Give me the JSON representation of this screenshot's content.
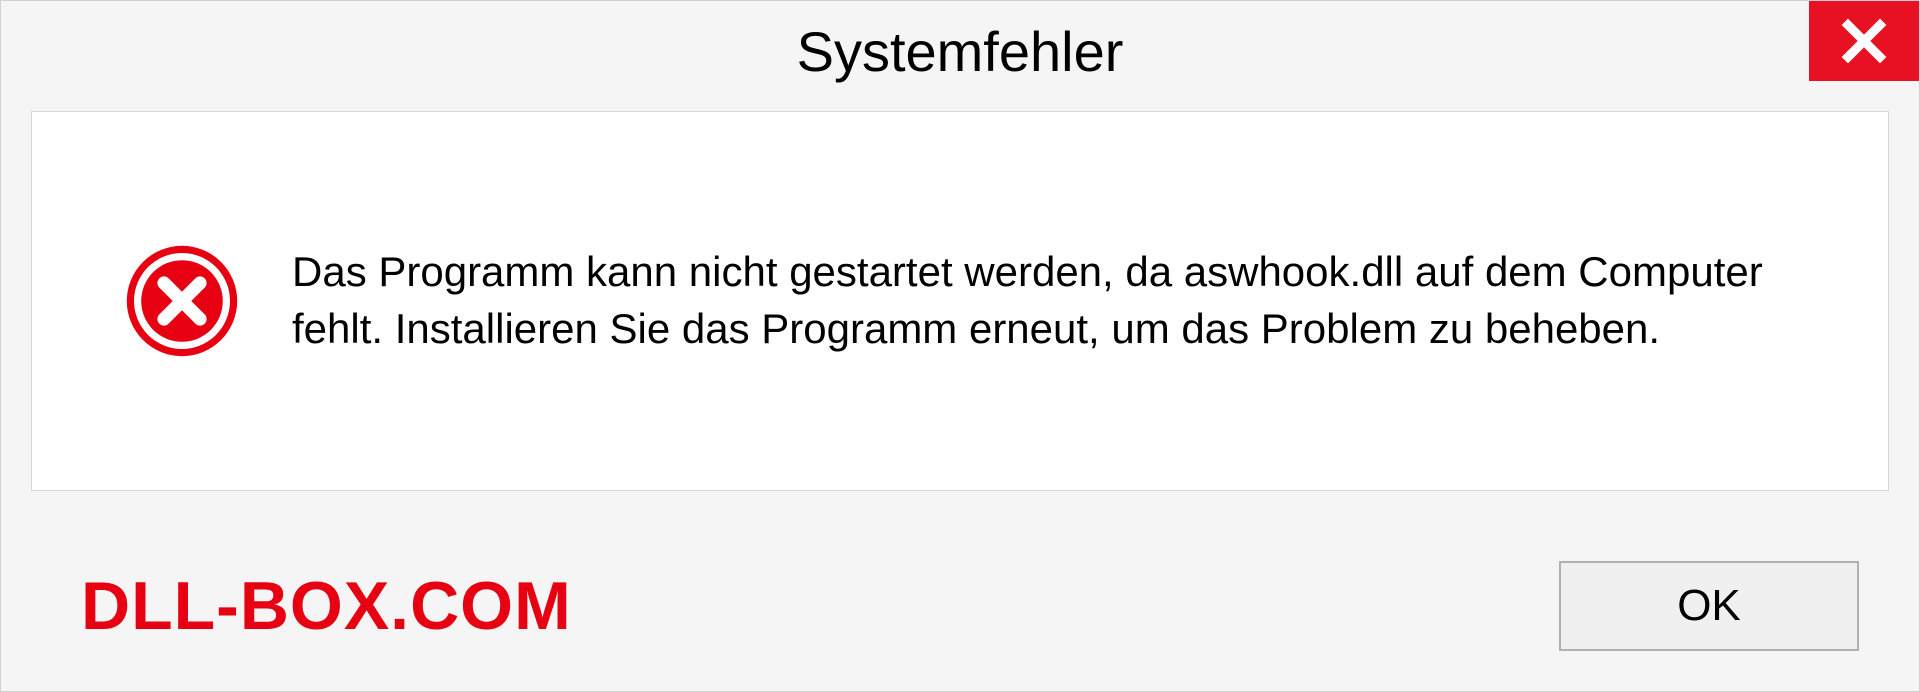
{
  "dialog": {
    "title": "Systemfehler",
    "message": "Das Programm kann nicht gestartet werden, da aswhook.dll auf dem Computer fehlt. Installieren Sie das Programm erneut, um das Problem zu beheben.",
    "ok_label": "OK"
  },
  "watermark": "DLL-BOX.COM"
}
